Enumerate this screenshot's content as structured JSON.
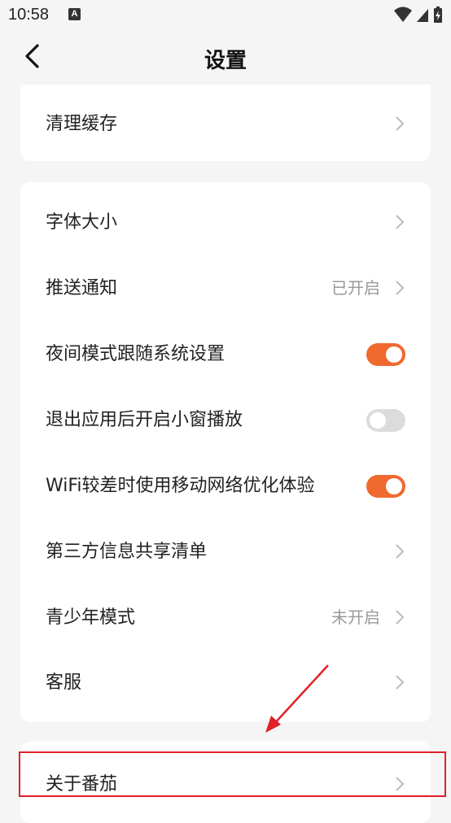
{
  "status_bar": {
    "time": "10:58",
    "notification_icon_letter": "A",
    "icons": [
      "wifi-icon",
      "signal-icon",
      "battery-icon"
    ]
  },
  "header": {
    "title": "设置",
    "back_icon": "back-arrow-icon"
  },
  "sections": [
    {
      "items": [
        {
          "label": "清理缓存",
          "type": "link"
        }
      ]
    },
    {
      "items": [
        {
          "label": "字体大小",
          "type": "link"
        },
        {
          "label": "推送通知",
          "type": "link",
          "value": "已开启"
        },
        {
          "label": "夜间模式跟随系统设置",
          "type": "toggle",
          "on": true
        },
        {
          "label": "退出应用后开启小窗播放",
          "type": "toggle",
          "on": false
        },
        {
          "label": "WiFi较差时使用移动网络优化体验",
          "type": "toggle",
          "on": true
        },
        {
          "label": "第三方信息共享清单",
          "type": "link"
        },
        {
          "label": "青少年模式",
          "type": "link",
          "value": "未开启"
        },
        {
          "label": "客服",
          "type": "link"
        }
      ]
    },
    {
      "items": [
        {
          "label": "关于番茄",
          "type": "link",
          "highlighted": true
        }
      ]
    }
  ],
  "colors": {
    "accent": "#f0692f",
    "toggle_off": "#dcdcdc",
    "background": "#f5f5f5",
    "annotation": "#e0202a"
  }
}
